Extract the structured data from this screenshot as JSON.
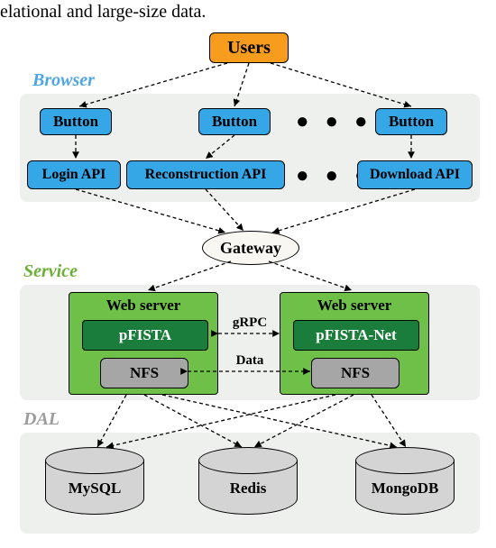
{
  "top_text": "elational and large-size data.",
  "users": "Users",
  "labels": {
    "browser": "Browser",
    "service": "Service",
    "dal": "DAL"
  },
  "browser": {
    "button1": "Button",
    "button2": "Button",
    "button3": "Button",
    "api1": "Login API",
    "api2": "Reconstruction API",
    "api3": "Download API",
    "dots_buttons": "● ● ●",
    "dots_api": "● ● ●"
  },
  "gateway": "Gateway",
  "service": {
    "ws_label": "Web server",
    "pfista": "pFISTA",
    "pfistanet": "pFISTA-Net",
    "nfs": "NFS",
    "grpc": "gRPC",
    "data": "Data"
  },
  "dal": {
    "mysql": "MySQL",
    "redis": "Redis",
    "mongodb": "MongoDB"
  }
}
